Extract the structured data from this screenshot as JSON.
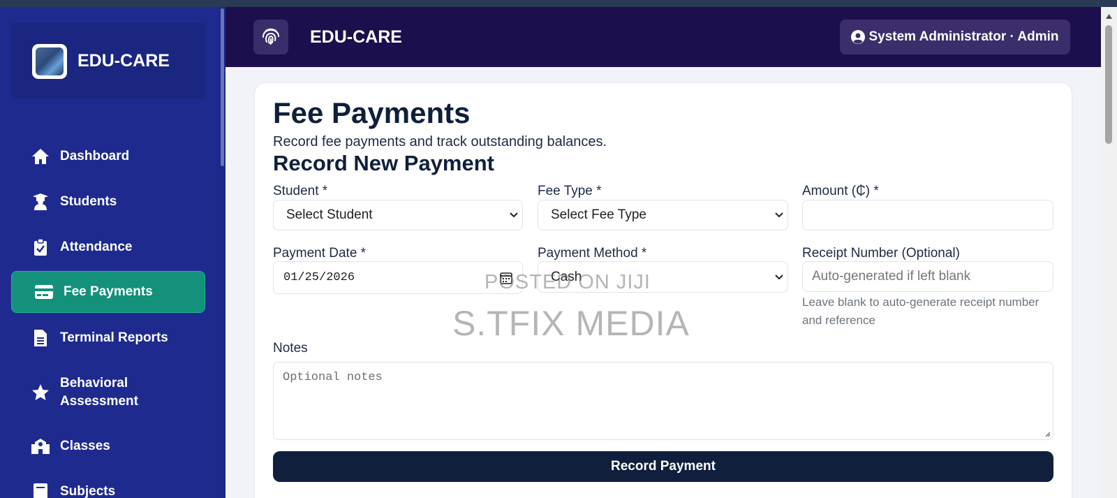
{
  "sidebar": {
    "brand_name": "EDU-CARE",
    "items": [
      {
        "label": "Dashboard",
        "icon": "home-icon"
      },
      {
        "label": "Students",
        "icon": "graduate-icon"
      },
      {
        "label": "Attendance",
        "icon": "clipboard-check-icon"
      },
      {
        "label": "Fee Payments",
        "icon": "credit-card-icon",
        "active": true
      },
      {
        "label": "Terminal Reports",
        "icon": "file-icon"
      },
      {
        "label": "Behavioral Assessment",
        "icon": "star-icon"
      },
      {
        "label": "Classes",
        "icon": "school-icon"
      },
      {
        "label": "Subjects",
        "icon": "book-icon"
      }
    ]
  },
  "header": {
    "title": "EDU-CARE",
    "user_label": "System Administrator · Admin",
    "fingerprint_icon": "fingerprint-icon",
    "user_icon": "user-circle-icon"
  },
  "main": {
    "title": "Fee Payments",
    "subtitle": "Record fee payments and track outstanding balances.",
    "section_title": "Record New Payment",
    "form": {
      "student_label": "Student *",
      "student_value": "Select Student",
      "fee_type_label": "Fee Type *",
      "fee_type_value": "Select Fee Type",
      "amount_label": "Amount (₵) *",
      "amount_value": "",
      "payment_date_label": "Payment Date *",
      "payment_date_value": "01/25/2026",
      "payment_method_label": "Payment Method *",
      "payment_method_value": "Cash",
      "receipt_label": "Receipt Number (Optional)",
      "receipt_placeholder": "Auto-generated if left blank",
      "receipt_help": "Leave blank to auto-generate receipt number and reference",
      "notes_label": "Notes",
      "notes_placeholder": "Optional notes",
      "submit_label": "Record Payment"
    }
  },
  "watermark": {
    "line1": "POSTED ON JIJI",
    "line2": "S.TFIX MEDIA"
  },
  "colors": {
    "sidebar_bg": "#1f2a8f",
    "header_bg": "#1d0e4d",
    "active_item": "#14917b",
    "primary_button": "#0f1f3c"
  }
}
